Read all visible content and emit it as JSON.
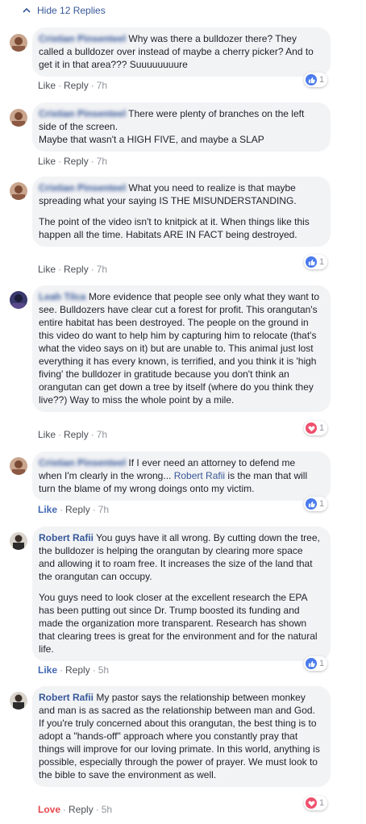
{
  "thread": {
    "hide_label": "Hide 12 Replies"
  },
  "colors": {
    "link": "#385898",
    "like_active": "#4267b2",
    "love_active": "#e5474e",
    "bubble_bg": "#f2f3f5",
    "like_badge": "#4a7aed",
    "love_badge": "#f0506e"
  },
  "comments": [
    {
      "author": "Cristian Pinsenteel",
      "paragraphs": [
        "Why was there a bulldozer there? They called a bulldozer over instead of maybe a cherry picker? And to get it in that area??? Suuuuuuuure"
      ],
      "actions": {
        "react": "Like",
        "reply": "Reply",
        "time": "7h"
      },
      "reaction": {
        "icon": "like-icon",
        "count": "1"
      }
    },
    {
      "author": "Cristian Pinsenteel",
      "paragraphs": [
        "There were plenty of branches on the left side of the screen.\nMaybe that wasn't a HIGH FIVE, and maybe a SLAP"
      ],
      "actions": {
        "react": "Like",
        "reply": "Reply",
        "time": "7h"
      }
    },
    {
      "author": "Cristian Pinsenteel",
      "paragraphs": [
        "What you need to realize is that maybe spreading what your saying IS THE MISUNDERSTANDING.",
        "The point of the video isn't to knitpick at it. When things like this happen all the time. Habitats ARE IN FACT being destroyed."
      ],
      "actions": {
        "react": "Like",
        "reply": "Reply",
        "time": "7h"
      },
      "reaction": {
        "icon": "like-icon",
        "count": "1"
      }
    },
    {
      "author": "Leah Tilca",
      "paragraphs": [
        "More evidence that people see only what they want to see. Bulldozers have clear cut a forest for profit. This orangutan's entire habitat has been destroyed. The people on the ground in this video do want to help him by capturing him to relocate (that's what the video says on it) but are unable to. This animal just lost everything it has every known, is terrified, and you think it is 'high fiving' the bulldozer in gratitude because you don't think an orangutan can get down a tree by itself (where do you think they live??) Way to miss the whole point by a mile."
      ],
      "actions": {
        "react": "Like",
        "reply": "Reply",
        "time": "7h"
      },
      "reaction": {
        "icon": "love-icon",
        "count": "1"
      }
    },
    {
      "author": "Cristian Pinsenteel",
      "text_before": "If I ever need an attorney to defend me when I'm clearly in the wrong... ",
      "mention": "Robert Rafii",
      "text_after": " is the man that will turn the blame of my wrong doings onto my victim.",
      "actions": {
        "react": "Like",
        "reply": "Reply",
        "time": "7h"
      },
      "reaction": {
        "icon": "like-icon",
        "count": "1"
      }
    },
    {
      "author": "Robert Rafii",
      "paragraphs": [
        "You guys have it all wrong. By cutting down the tree, the bulldozer is helping the orangutan by clearing more space and allowing it to roam free. It increases the size of the land that the orangutan can occupy.",
        "You guys need to look closer at the excellent research the EPA has been putting out since Dr. Trump boosted its funding and made the organization more transparent. Research has shown that clearing trees is great for the environment and for the natural life."
      ],
      "actions": {
        "react": "Like",
        "reply": "Reply",
        "time": "5h"
      },
      "reaction": {
        "icon": "like-icon",
        "count": "1"
      }
    },
    {
      "author": "Robert Rafii",
      "paragraphs": [
        "My pastor says the relationship between monkey and man is as sacred as the relationship between man and God. If you're truly concerned about this orangutan, the best thing is to adopt a \"hands-off\" approach where you constantly pray that things will improve for our loving primate. In this world, anything is possible, especially through the power of prayer. We must look to the bible to save the environment as well."
      ],
      "actions": {
        "react": "Love",
        "reply": "Reply",
        "time": "5h"
      },
      "reaction": {
        "icon": "love-icon",
        "count": "1"
      }
    }
  ]
}
